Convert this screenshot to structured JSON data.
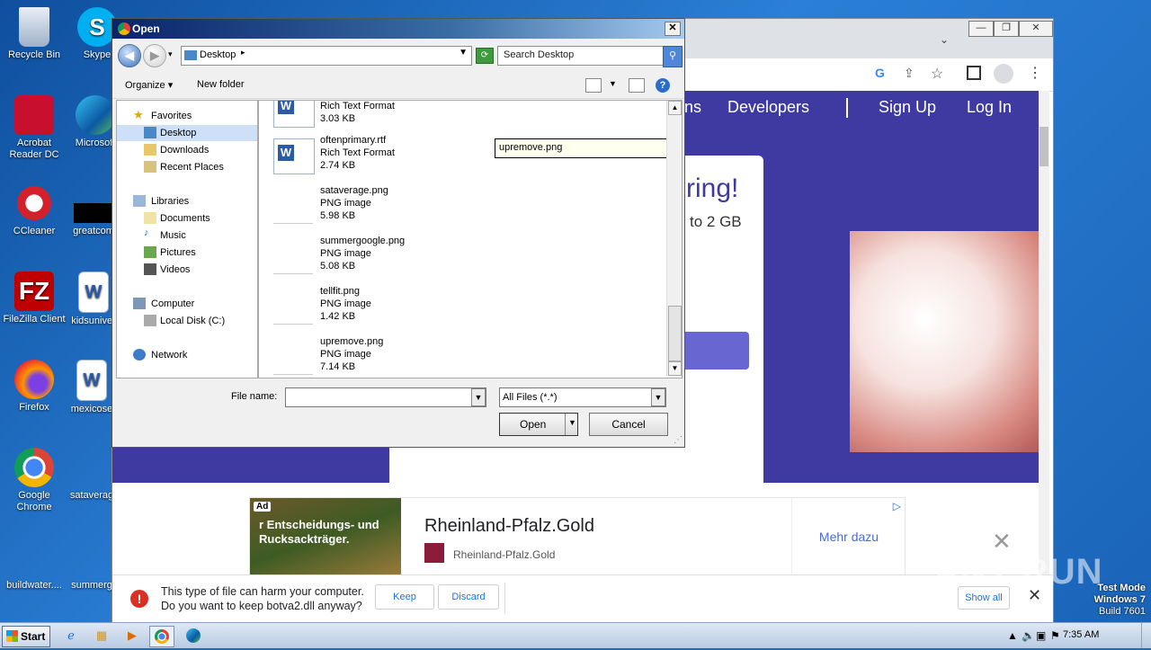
{
  "desktop": {
    "icons": [
      {
        "label": "Recycle Bin",
        "icon": "recycle-bin-icon"
      },
      {
        "label": "Acrobat Reader DC",
        "icon": "acrobat-icon"
      },
      {
        "label": "CCleaner",
        "icon": "ccleaner-icon"
      },
      {
        "label": "FileZilla Client",
        "icon": "filezilla-icon"
      },
      {
        "label": "Firefox",
        "icon": "firefox-icon"
      },
      {
        "label": "Google Chrome",
        "icon": "chrome-icon"
      },
      {
        "label": "buildwater....",
        "icon": "file-icon"
      },
      {
        "label": "Skype",
        "icon": "skype-icon"
      },
      {
        "label": "Microsoft",
        "icon": "edge-icon"
      },
      {
        "label": "greatcom",
        "icon": "file-icon"
      },
      {
        "label": "kidsuniver",
        "icon": "word-icon"
      },
      {
        "label": "mexicose",
        "icon": "word-icon"
      },
      {
        "label": "sataverag",
        "icon": "file-icon"
      },
      {
        "label": "summerg",
        "icon": "file-icon"
      }
    ],
    "colors": {
      "wallpaper": "#1c6cc4"
    }
  },
  "browser": {
    "nav": [
      "ns",
      "Developers",
      "Sign Up",
      "Log In"
    ],
    "hero_heading": "ring!",
    "hero_sub": "to 2 GB",
    "ad": {
      "badge": "Ad",
      "image_text": "r Entscheidungs- und Rucksackträger.",
      "title": "Rheinland-Pfalz.Gold",
      "subtitle": "Rheinland-Pfalz.Gold",
      "cta": "Mehr dazu"
    },
    "download_bar": {
      "message_line1": "This type of file can harm your computer.",
      "message_line2": "Do you want to keep botva2.dll anyway?",
      "keep": "Keep",
      "discard": "Discard",
      "show_all": "Show all"
    }
  },
  "dialog": {
    "title": "Open",
    "location": "Desktop",
    "search_placeholder": "Search Desktop",
    "organize": "Organize",
    "new_folder": "New folder",
    "nav": {
      "favorites": "Favorites",
      "desktop": "Desktop",
      "downloads": "Downloads",
      "recent": "Recent Places",
      "libraries": "Libraries",
      "documents": "Documents",
      "music": "Music",
      "pictures": "Pictures",
      "videos": "Videos",
      "computer": "Computer",
      "local_disk": "Local Disk (C:)",
      "network": "Network"
    },
    "files": [
      {
        "name": "",
        "type": "Rich Text Format",
        "size": "3.03 KB",
        "kind": "rtf"
      },
      {
        "name": "oftenprimary.rtf",
        "type": "Rich Text Format",
        "size": "2.74 KB",
        "kind": "rtf"
      },
      {
        "name": "sataverage.png",
        "type": "PNG image",
        "size": "5.98 KB",
        "kind": "png"
      },
      {
        "name": "summergoogle.png",
        "type": "PNG image",
        "size": "5.08 KB",
        "kind": "png"
      },
      {
        "name": "tellfit.png",
        "type": "PNG image",
        "size": "1.42 KB",
        "kind": "png"
      },
      {
        "name": "upremove.png",
        "type": "PNG image",
        "size": "7.14 KB",
        "kind": "png"
      }
    ],
    "rename_value": "upremove.png",
    "file_name_label": "File name:",
    "file_name_value": "",
    "file_type": "All Files (*.*)",
    "open": "Open",
    "cancel": "Cancel"
  },
  "taskbar": {
    "start": "Start",
    "time": "7:35 AM"
  },
  "watermark": {
    "test_mode": "Test Mode",
    "os": "Windows 7",
    "build": "Build 7601",
    "logo": "ANY RUN"
  }
}
